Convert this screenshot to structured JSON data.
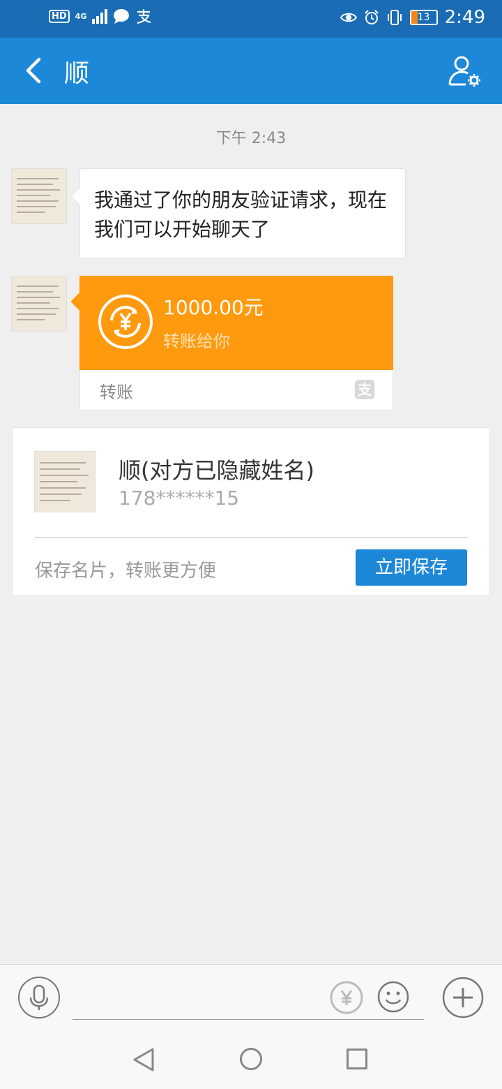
{
  "status_bar": {
    "hd": "HD",
    "network": "4G",
    "time": "2:49",
    "battery": "13"
  },
  "header": {
    "title": "顺"
  },
  "chat": {
    "timestamp": "下午 2:43",
    "message_text": "我通过了你的朋友验证请求，现在我们可以开始聊天了",
    "transfer": {
      "amount": "1000.00元",
      "subtitle": "转账给你",
      "label": "转账",
      "brand_glyph": "支"
    }
  },
  "contact_card": {
    "name": "顺(对方已隐藏姓名)",
    "phone": "178******15",
    "hint": "保存名片，转账更方便",
    "save_button": "立即保存"
  },
  "icons": {
    "back": "chevron-left-icon",
    "profile_settings": "user-gear-icon",
    "mic": "microphone-icon",
    "transfer_rmb": "yuan-transfer-icon",
    "emoji": "smiley-icon",
    "plus": "plus-circle-icon"
  },
  "colors": {
    "status_bar": "#1a6cb5",
    "top_bar": "#1e88d8",
    "transfer_orange": "#ff9a0e",
    "button_blue": "#1e88d8"
  }
}
